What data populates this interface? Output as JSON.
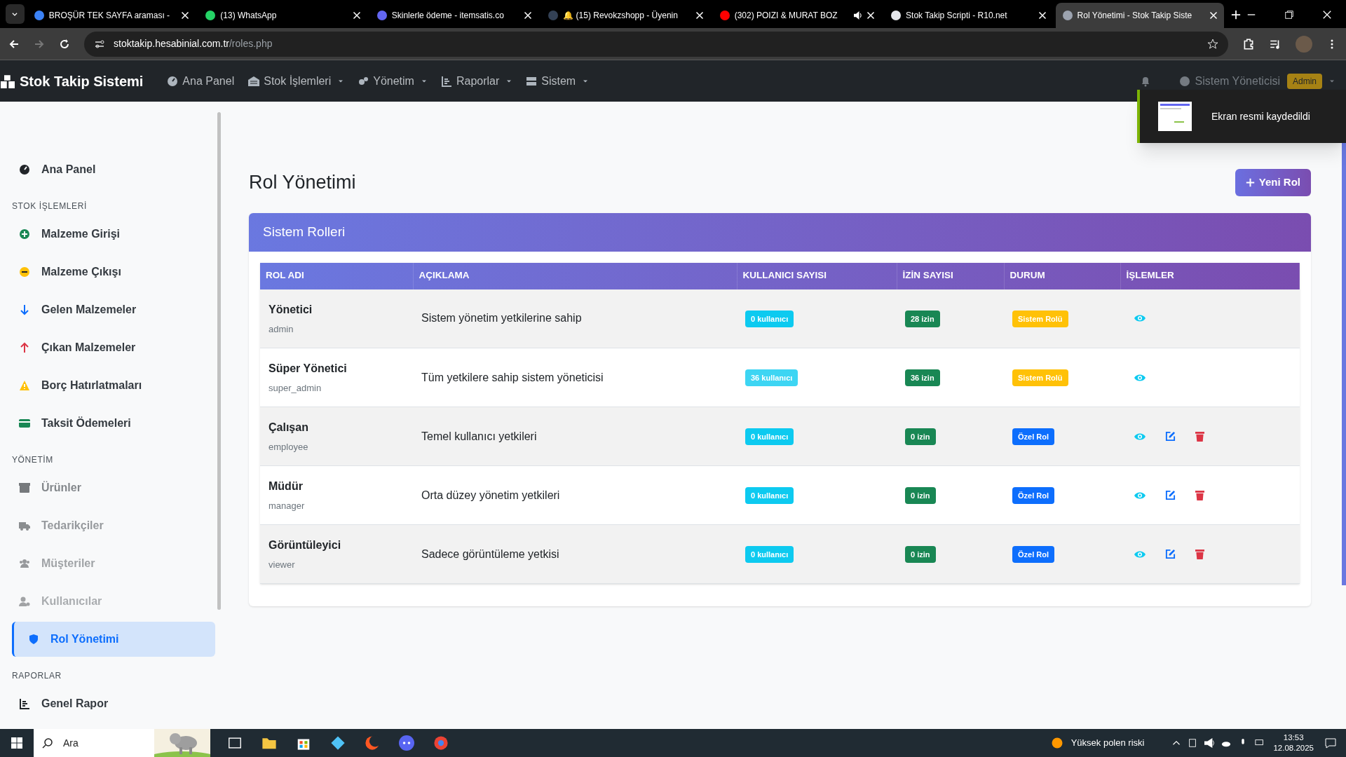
{
  "browser": {
    "tabs": [
      {
        "title": "BROŞÜR TEK SAYFA araması -",
        "selected": false,
        "color": "#3b82f6"
      },
      {
        "title": "(13) WhatsApp",
        "selected": false,
        "color": "#25d366"
      },
      {
        "title": "Skinlerle ödeme - itemsatis.co",
        "selected": false,
        "color": "#6366f1"
      },
      {
        "title": "🔔 (15) Revokzshopp - Üyenin",
        "selected": false,
        "color": "#334155"
      },
      {
        "title": "(302) POIZI & MURAT BOZ",
        "selected": false,
        "color": "#ff0000",
        "audio": true
      },
      {
        "title": "Stok Takip Scripti - R10.net",
        "selected": false,
        "color": "#e5e7eb"
      },
      {
        "title": "Rol Yönetimi - Stok Takip Siste",
        "selected": true,
        "color": "#9ca3af"
      }
    ],
    "url_host": "stoktakip.hesabinial.com.tr",
    "url_path": "/roles.php"
  },
  "navbar": {
    "brand": "Stok Takip Sistemi",
    "menu": [
      {
        "label": "Ana Panel",
        "dropdown": false
      },
      {
        "label": "Stok İşlemleri",
        "dropdown": true
      },
      {
        "label": "Yönetim",
        "dropdown": true
      },
      {
        "label": "Raporlar",
        "dropdown": true
      },
      {
        "label": "Sistem",
        "dropdown": true
      }
    ],
    "user": "Sistem Yöneticisi",
    "user_badge": "Admin"
  },
  "toast": {
    "message": "Ekran resmi kaydedildi"
  },
  "sidebar": {
    "items": [
      {
        "kind": "link",
        "label": "Ana Panel",
        "selected": false,
        "dimmed": false
      },
      {
        "kind": "heading",
        "label": "STOK İŞLEMLERİ"
      },
      {
        "kind": "link",
        "label": "Malzeme Girişi",
        "selected": false,
        "dimmed": false
      },
      {
        "kind": "link",
        "label": "Malzeme Çıkışı",
        "selected": false,
        "dimmed": false
      },
      {
        "kind": "link",
        "label": "Gelen Malzemeler",
        "selected": false,
        "dimmed": false
      },
      {
        "kind": "link",
        "label": "Çıkan Malzemeler",
        "selected": false,
        "dimmed": false
      },
      {
        "kind": "link",
        "label": "Borç Hatırlatmaları",
        "selected": false,
        "dimmed": false
      },
      {
        "kind": "link",
        "label": "Taksit Ödemeleri",
        "selected": false,
        "dimmed": false
      },
      {
        "kind": "heading",
        "label": "YÖNETİM"
      },
      {
        "kind": "link",
        "label": "Ürünler",
        "selected": false,
        "dimmed": true
      },
      {
        "kind": "link",
        "label": "Tedarikçiler",
        "selected": false,
        "dimmed": true
      },
      {
        "kind": "link",
        "label": "Müşteriler",
        "selected": false,
        "dimmed": true
      },
      {
        "kind": "link",
        "label": "Kullanıcılar",
        "selected": false,
        "dimmed": true
      },
      {
        "kind": "link",
        "label": "Rol Yönetimi",
        "selected": true,
        "dimmed": false
      },
      {
        "kind": "heading",
        "label": "RAPORLAR"
      },
      {
        "kind": "link",
        "label": "Genel Rapor",
        "selected": false,
        "dimmed": false
      }
    ]
  },
  "page": {
    "title": "Rol Yönetimi",
    "new_button": "Yeni Rol"
  },
  "card": {
    "title": "Sistem Rolleri"
  },
  "table": {
    "columns": [
      "ROL ADI",
      "AÇIKLAMA",
      "KULLANICI SAYISI",
      "İZİN SAYISI",
      "DURUM",
      "İŞLEMLER"
    ],
    "rows": [
      {
        "name": "Yönetici",
        "code": "admin",
        "description": "Sistem yönetim yetkilerine sahip",
        "users": "0 kullanıcı",
        "permissions": "28 izin",
        "status": "Sistem Rolü",
        "system_role": true,
        "editable": false
      },
      {
        "name": "Süper Yönetici",
        "code": "super_admin",
        "description": "Tüm yetkilere sahip sistem yöneticisi",
        "users": "36 kullanıcı",
        "permissions": "36 izin",
        "status": "Sistem Rolü",
        "system_role": true,
        "editable": false
      },
      {
        "name": "Çalışan",
        "code": "employee",
        "description": "Temel kullanıcı yetkileri",
        "users": "0 kullanıcı",
        "permissions": "0 izin",
        "status": "Özel Rol",
        "system_role": false,
        "editable": true
      },
      {
        "name": "Müdür",
        "code": "manager",
        "description": "Orta düzey yönetim yetkileri",
        "users": "0 kullanıcı",
        "permissions": "0 izin",
        "status": "Özel Rol",
        "system_role": false,
        "editable": true
      },
      {
        "name": "Görüntüleyici",
        "code": "viewer",
        "description": "Sadece görüntüleme yetkisi",
        "users": "0 kullanıcı",
        "permissions": "0 izin",
        "status": "Özel Rol",
        "system_role": false,
        "editable": true
      }
    ]
  },
  "taskbar": {
    "search": "Ara",
    "weather": "Yüksek polen riski",
    "time": "13:53",
    "date": "12.08.2025"
  }
}
